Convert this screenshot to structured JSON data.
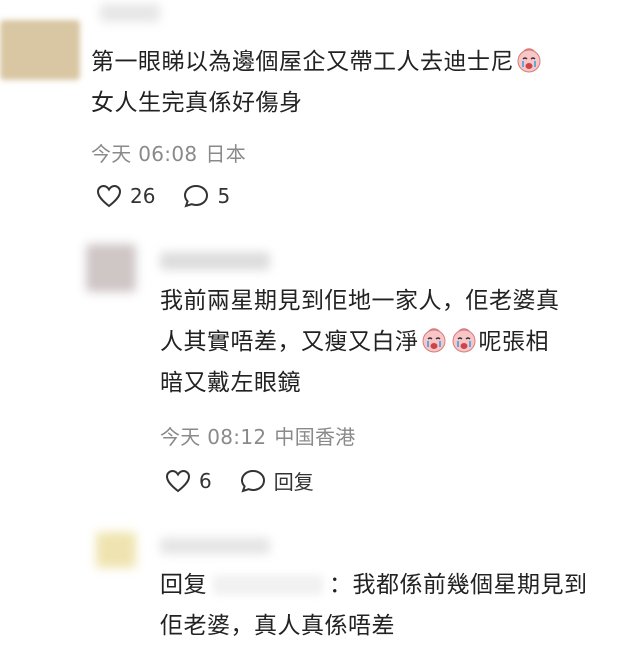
{
  "comment1": {
    "text_line1": "第一眼睇以為邊個屋企又帶工人去迪士尼",
    "text_line2": "女人生完真係好傷身",
    "emoji": "crying-face-emoji",
    "time": "今天 06:08",
    "location": "日本",
    "likes": "26",
    "replies": "5"
  },
  "reply1": {
    "text_line1": "我前兩星期見到佢地一家人，佢老婆真",
    "text_line2a": "人其實唔差，又瘦又白淨",
    "text_line2b": "呢張相",
    "text_line3": "暗又戴左眼鏡",
    "emoji": "crying-face-emoji",
    "time": "今天 08:12",
    "location": "中国香港",
    "likes": "6",
    "reply_label": "回复"
  },
  "reply2": {
    "prefix": "回复",
    "text_line1": "：我都係前幾個星期見到",
    "text_line2": "佢老婆，真人真係唔差"
  },
  "colors": {
    "text": "#222222",
    "meta": "#8a8a8a",
    "emoji_face": "#f7b8b8"
  }
}
